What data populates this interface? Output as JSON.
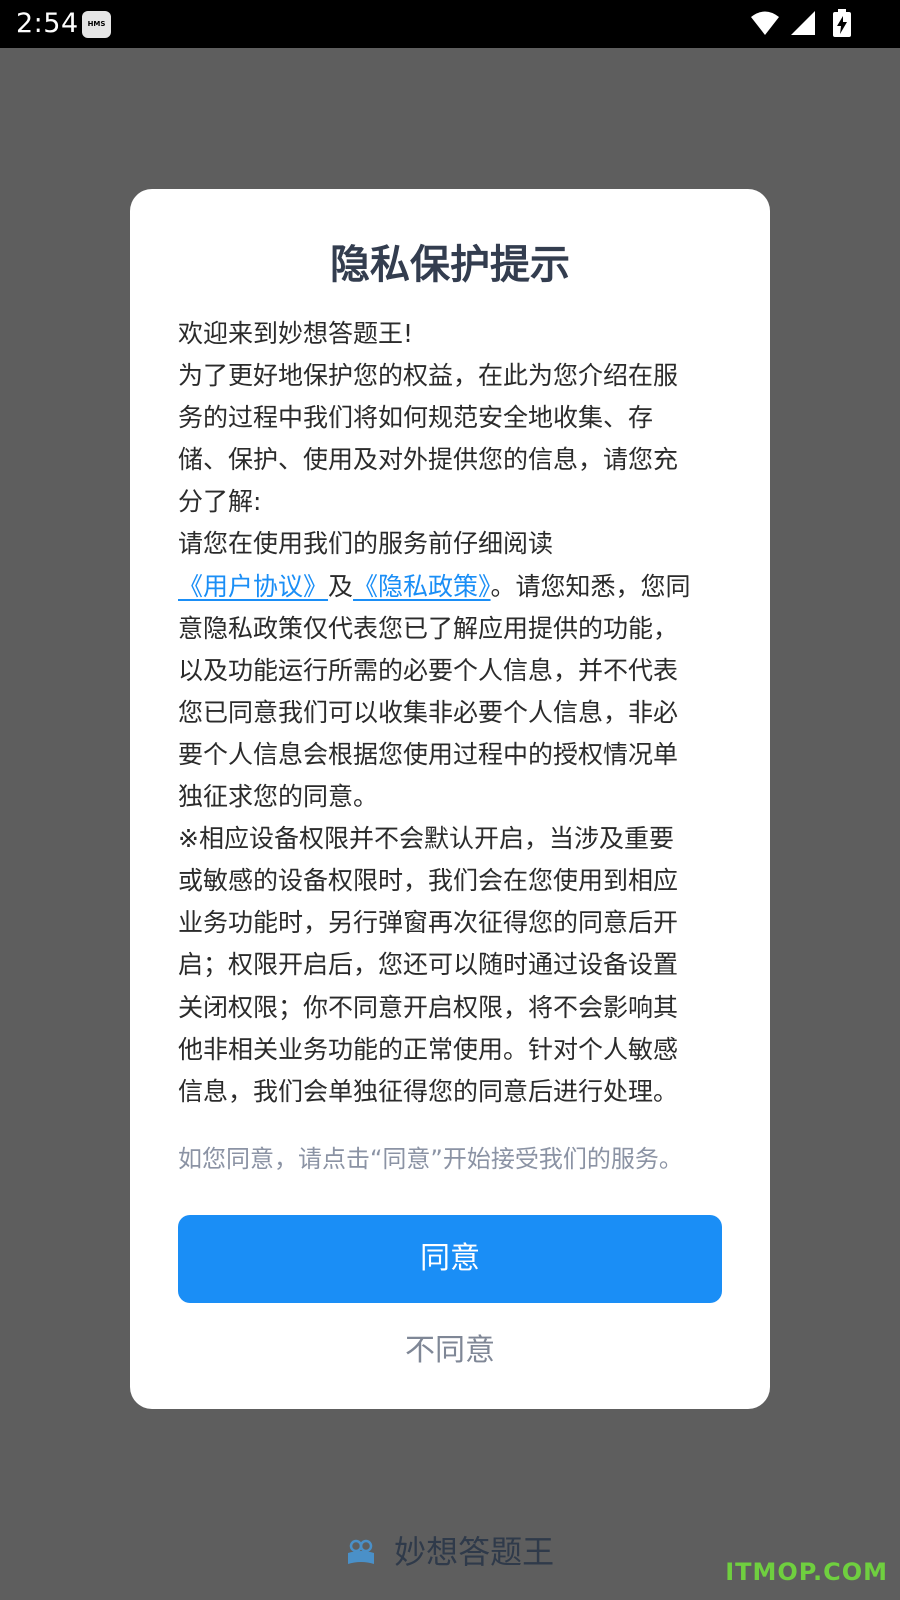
{
  "status_bar": {
    "time": "2:54",
    "badge": "HMS",
    "icons": [
      "wifi-icon",
      "cell-signal-icon",
      "battery-charging-icon"
    ]
  },
  "dialog": {
    "title": "隐私保护提示",
    "welcome": "欢迎来到妙想答题王!",
    "para1": "为了更好地保护您的权益，在此为您介绍在服务的过程中我们将如何规范安全地收集、存储、保护、使用及对外提供您的信息，请您充分了解:",
    "para2_prefix": "请您在使用我们的服务前仔细阅读",
    "user_agreement_link": "《用户协议》",
    "and": "及",
    "privacy_policy_link": "《隐私政策》",
    "para2_suffix": "。请您知悉，您同意隐私政策仅代表您已了解应用提供的功能，以及功能运行所需的必要个人信息，并不代表您已同意我们可以收集非必要个人信息，非必要个人信息会根据您使用过程中的授权情况单独征求您的同意。",
    "para3": "※相应设备权限并不会默认开启，当涉及重要或敏感的设备权限时，我们会在您使用到相应业务功能时，另行弹窗再次征得您的同意后开启；权限开启后，您还可以随时通过设备设置关闭权限；你不同意开启权限，将不会影响其他非相关业务功能的正常使用。针对个人敏感信息，我们会单独征得您的同意后进行处理。",
    "hint": "如您同意，请点击“同意”开始接受我们的服务。",
    "agree_label": "同意",
    "disagree_label": "不同意"
  },
  "footer": {
    "app_name": "妙想答题王",
    "logo_icon": "book-reader-icon"
  },
  "watermark": "ITMOP.COM",
  "colors": {
    "accent": "#1a8ef6",
    "overlay": "#5e5e5e",
    "title": "#333d4f",
    "hint": "#8b93a4",
    "watermark": "#6fcf3f"
  }
}
